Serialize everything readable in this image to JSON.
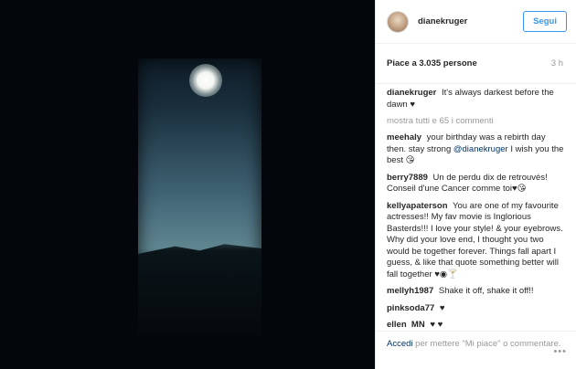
{
  "post": {
    "username": "dianekruger",
    "follow_label": "Segui",
    "likes": "Piace a 3.035 persone",
    "time": "3 h"
  },
  "caption": {
    "username": "dianekruger",
    "text": "It's always darkest before the dawn ♥"
  },
  "show_all_comments": "mostra tutti e 65 i commenti",
  "comments": [
    {
      "user": "meehaly",
      "text_before": "your birthday was a rebirth day then. stay strong",
      "mention": "@dianekruger",
      "text_after": "I wish you the best 😘"
    },
    {
      "user": "berry7889",
      "text": "Un de perdu dix de retrouvés! Conseil d'une Cancer comme toi♥😘"
    },
    {
      "user": "kellyapaterson",
      "text": "You are one of my favourite actresses!! My fav movie is Inglorious Basterds!!! I love your style! & your eyebrows. Why did your love end, I thought you two would be together forever. Things fall apart I guess, & like that quote something better will fall together ♥◉🍸"
    },
    {
      "user": "mellyh1987",
      "text": "Shake it off, shake it off!!"
    },
    {
      "user": "pinksoda77",
      "text": "♥"
    },
    {
      "user": "ellen_MN",
      "text": "♥ ♥"
    }
  ],
  "footer": {
    "login_label": "Accedi",
    "rest": "per mettere \"Mi piace\" o commentare."
  },
  "icons": {
    "more": "more-options-icon"
  }
}
